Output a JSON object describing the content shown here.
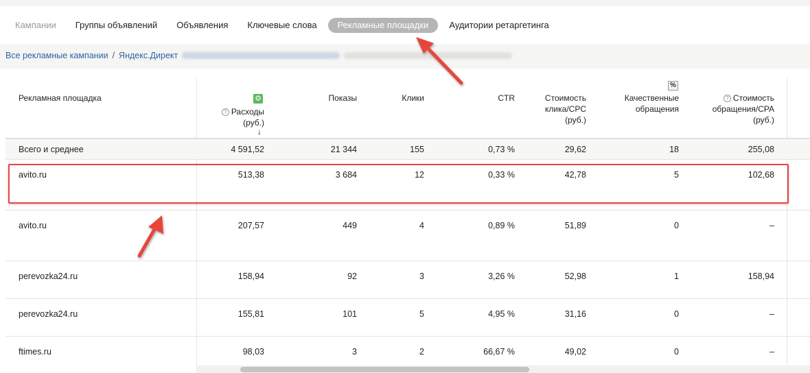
{
  "tabs": [
    {
      "label": "Кампании",
      "state": "muted"
    },
    {
      "label": "Группы объявлений",
      "state": "normal"
    },
    {
      "label": "Объявления",
      "state": "normal"
    },
    {
      "label": "Ключевые слова",
      "state": "normal"
    },
    {
      "label": "Рекламные площадки",
      "state": "active"
    },
    {
      "label": "Аудитории ретаргетинга",
      "state": "normal"
    }
  ],
  "breadcrumb": {
    "all_campaigns": "Все рекламные кампании",
    "separator": "/",
    "platform": "Яндекс.Директ"
  },
  "table": {
    "headers": {
      "placement": "Рекламная площадка",
      "spend_line1": "Расходы",
      "spend_line2": "(руб.)",
      "shows": "Показы",
      "clicks": "Клики",
      "ctr": "CTR",
      "cpc_line1": "Стоимость",
      "cpc_line2": "клика/CPC",
      "cpc_line3": "(руб.)",
      "quality_line1": "Качественные",
      "quality_line2": "обращения",
      "quality_pct": "%",
      "cpa_line1": "Стоимость",
      "cpa_line2": "обращения/CPA",
      "cpa_line3": "(руб.)",
      "sort_arrow": "↓"
    },
    "total": {
      "label": "Всего и среднее",
      "spend": "4 591,52",
      "shows": "21 344",
      "clicks": "155",
      "ctr": "0,73 %",
      "cpc": "29,62",
      "quality": "18",
      "cpa": "255,08"
    },
    "rows": [
      {
        "name": "avito.ru",
        "spend": "513,38",
        "shows": "3 684",
        "clicks": "12",
        "ctr": "0,33 %",
        "cpc": "42,78",
        "quality": "5",
        "cpa": "102,68"
      },
      {
        "name": "avito.ru",
        "spend": "207,57",
        "shows": "449",
        "clicks": "4",
        "ctr": "0,89 %",
        "cpc": "51,89",
        "quality": "0",
        "cpa": "–"
      },
      {
        "name": "perevozka24.ru",
        "spend": "158,94",
        "shows": "92",
        "clicks": "3",
        "ctr": "3,26 %",
        "cpc": "52,98",
        "quality": "1",
        "cpa": "158,94"
      },
      {
        "name": "perevozka24.ru",
        "spend": "155,81",
        "shows": "101",
        "clicks": "5",
        "ctr": "4,95 %",
        "cpc": "31,16",
        "quality": "0",
        "cpa": "–"
      },
      {
        "name": "ftimes.ru",
        "spend": "98,03",
        "shows": "3",
        "clicks": "2",
        "ctr": "66,67 %",
        "cpc": "49,02",
        "quality": "0",
        "cpa": "–"
      }
    ]
  },
  "icons": {
    "settings": "gear-icon",
    "help": "question-icon",
    "percent_toggle": "percent-icon"
  },
  "colors": {
    "active_tab": "#b5b5b5",
    "link": "#2f62a7",
    "highlight": "#e04848",
    "settings_icon": "#5cb85c"
  }
}
